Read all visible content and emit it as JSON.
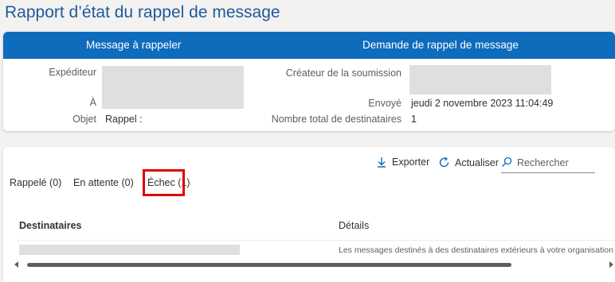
{
  "page_title": "Rapport d’état du rappel de message",
  "card": {
    "header_left": "Message à rappeler",
    "header_right": "Demande de rappel de message",
    "sender_label": "Expéditeur",
    "to_label": "À",
    "subject_label": "Objet",
    "subject_value": "Rappel :",
    "creator_label": "Créateur de la soumission",
    "sent_label": "Envoyé",
    "sent_value": "jeudi 2 novembre 2023 11:04:49",
    "total_label": "Nombre total de destinataires",
    "total_value": "1"
  },
  "toolbar": {
    "export_label": "Exporter",
    "refresh_label": "Actualiser",
    "search_placeholder": "Rechercher"
  },
  "tabs": [
    {
      "label": "Rappelé (0)"
    },
    {
      "label": "En attente (0)"
    },
    {
      "label": "Échec (1)",
      "active": true
    }
  ],
  "table": {
    "columns": [
      "Destinataires",
      "Détails"
    ],
    "rows": [
      {
        "details": "Les messages destinés à des destinataires extérieurs à votre organisation ou s"
      }
    ]
  },
  "colors": {
    "accent": "#0f6cbd",
    "title": "#1f5a9d",
    "highlight_box": "#e00000"
  }
}
